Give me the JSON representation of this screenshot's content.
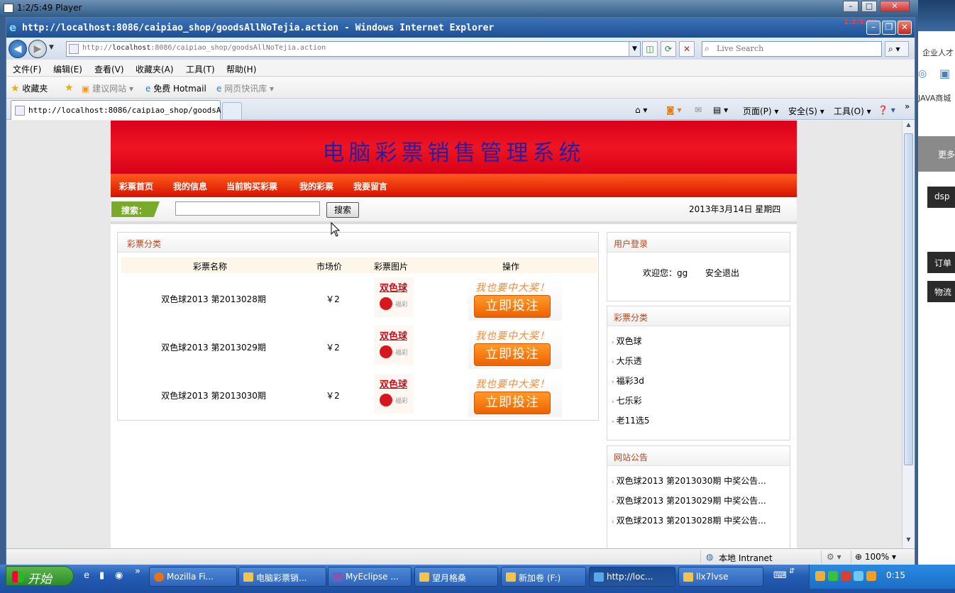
{
  "player": {
    "title": "1:2/5:49 Player"
  },
  "window": {
    "title": "http://localhost:8086/caipiao_shop/goodsAllNoTejia.action - Windows Internet Explorer",
    "corner_time": "1:2/5:49"
  },
  "address": {
    "url_prefix": "http://",
    "url_host": "localhost",
    "url_rest": ":8086/caipiao_shop/goodsAllNoTejia.action",
    "search_placeholder": "Live Search"
  },
  "menu": [
    "文件(F)",
    "编辑(E)",
    "查看(V)",
    "收藏夹(A)",
    "工具(T)",
    "帮助(H)"
  ],
  "favorites": {
    "label": "收藏夹",
    "items": [
      "建议网站 ▾",
      "免费 Hotmail",
      "网页快讯库 ▾"
    ]
  },
  "tab": {
    "label": "http://localhost:8086/caipiao_shop/goodsA..."
  },
  "commands": [
    "页面(P) ▾",
    "安全(S) ▾",
    "工具(O) ▾"
  ],
  "site": {
    "banner_title": "电脑彩票销售管理系统",
    "nav": [
      "彩票首页",
      "我的信息",
      "当前购买彩票",
      "我的彩票",
      "我要留言"
    ],
    "search_label": "搜索：",
    "search_button": "搜索",
    "date": "2013年3月14日 星期四"
  },
  "catalog": {
    "title": "彩票分类",
    "columns": [
      "彩票名称",
      "市场价",
      "彩票图片",
      "操作"
    ],
    "rows": [
      {
        "name": "双色球2013 第2013028期",
        "price": "￥2"
      },
      {
        "name": "双色球2013 第2013029期",
        "price": "￥2"
      },
      {
        "name": "双色球2013 第2013030期",
        "price": "￥2"
      }
    ],
    "logo_text": "双色球",
    "logo_sub": "福彩",
    "cta_slogan": "我也要中大奖！",
    "cta_button": "立即投注"
  },
  "login": {
    "title": "用户登录",
    "welcome": "欢迎您：gg",
    "logout": "安全退出"
  },
  "categories": {
    "title": "彩票分类",
    "items": [
      "双色球",
      "大乐透",
      "福彩3d",
      "七乐彩",
      "老11选5"
    ]
  },
  "notices": {
    "title": "网站公告",
    "items": [
      "双色球2013 第2013030期 中奖公告...",
      "双色球2013 第2013029期 中奖公告...",
      "双色球2013 第2013028期 中奖公告..."
    ]
  },
  "status": {
    "zone": "本地 Intranet",
    "zoom": "100%"
  },
  "taskbar": {
    "start": "开始",
    "tasks": [
      "Mozilla Fi...",
      "电脑彩票销...",
      "MyEclipse ...",
      "望月格桑",
      "新加卷 (F:)",
      "http://loc...",
      "llx7lvse"
    ],
    "clock": "0:15"
  },
  "desktop": {
    "texts": [
      "企业人才",
      "JAVA商城",
      "更多",
      "dsp",
      "订单",
      "物流"
    ]
  },
  "colors": {
    "banner": "#e2101d",
    "nav": "#e8340c",
    "cta": "#f47a10",
    "accent_text": "#b4441c"
  }
}
